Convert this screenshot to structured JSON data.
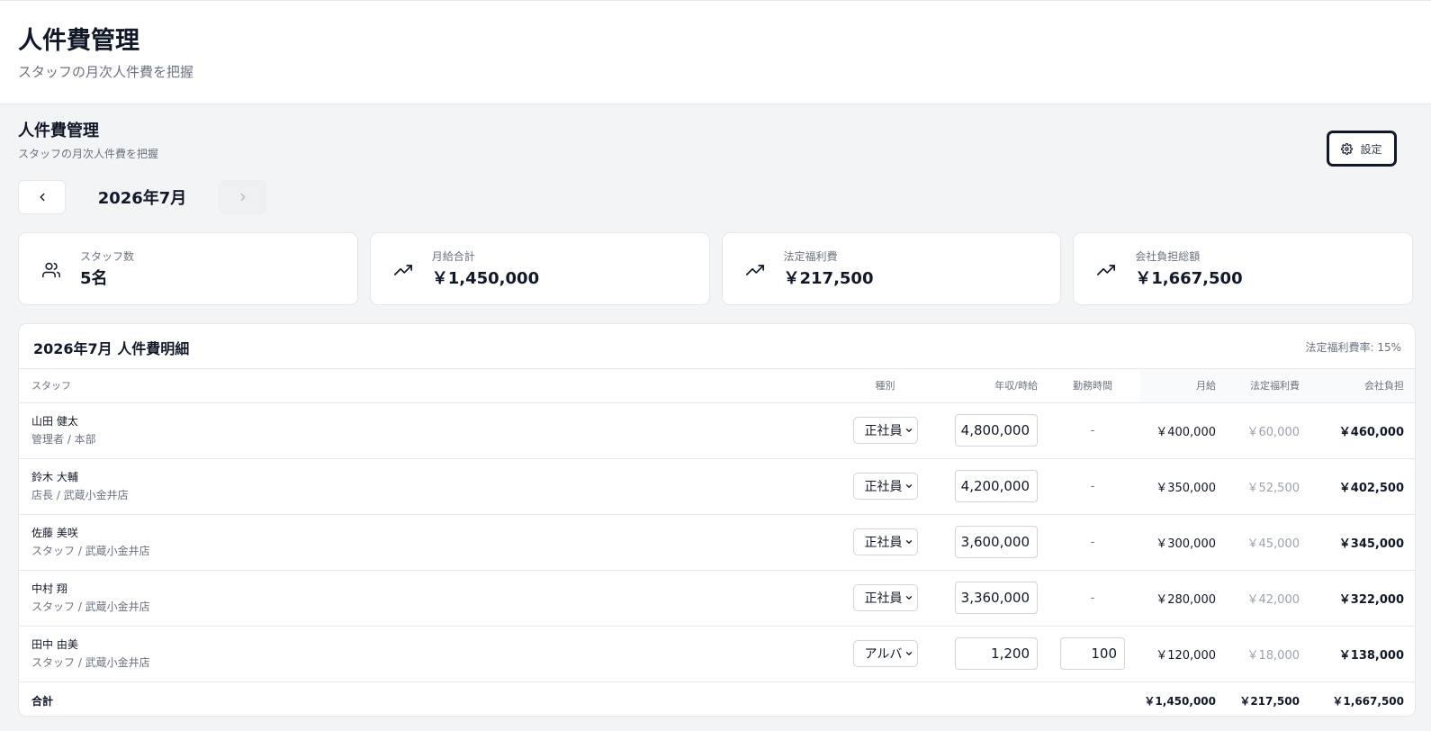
{
  "page": {
    "title": "人件費管理",
    "subtitle": "スタッフの月次人件費を把握"
  },
  "section": {
    "title": "人件費管理",
    "subtitle": "スタッフの月次人件費を把握",
    "settings_label": "設定"
  },
  "month": {
    "label": "2026年7月"
  },
  "stats": [
    {
      "label": "スタッフ数",
      "value": "5名",
      "icon": "users-icon"
    },
    {
      "label": "月給合計",
      "value": "￥1,450,000",
      "icon": "trending-up-icon"
    },
    {
      "label": "法定福利費",
      "value": "￥217,500",
      "icon": "trending-up-icon"
    },
    {
      "label": "会社負担総額",
      "value": "￥1,667,500",
      "icon": "trending-up-icon"
    }
  ],
  "table": {
    "title": "2026年7月 人件費明細",
    "rate_label": "法定福利費率: 15%",
    "headers": {
      "staff": "スタッフ",
      "type": "種別",
      "pay": "年収/時給",
      "hours": "勤務時間",
      "monthly": "月給",
      "welfare": "法定福利費",
      "burden": "会社負担"
    },
    "rows": [
      {
        "name": "山田 健太",
        "role": "管理者 / 本部",
        "type": "正社員",
        "pay": "4,800,000",
        "hours": "-",
        "monthly": "￥400,000",
        "welfare": "￥60,000",
        "burden": "￥460,000"
      },
      {
        "name": "鈴木 大輔",
        "role": "店長 / 武蔵小金井店",
        "type": "正社員",
        "pay": "4,200,000",
        "hours": "-",
        "monthly": "￥350,000",
        "welfare": "￥52,500",
        "burden": "￥402,500"
      },
      {
        "name": "佐藤 美咲",
        "role": "スタッフ / 武蔵小金井店",
        "type": "正社員",
        "pay": "3,600,000",
        "hours": "-",
        "monthly": "￥300,000",
        "welfare": "￥45,000",
        "burden": "￥345,000"
      },
      {
        "name": "中村 翔",
        "role": "スタッフ / 武蔵小金井店",
        "type": "正社員",
        "pay": "3,360,000",
        "hours": "-",
        "monthly": "￥280,000",
        "welfare": "￥42,000",
        "burden": "￥322,000"
      },
      {
        "name": "田中 由美",
        "role": "スタッフ / 武蔵小金井店",
        "type": "アルバ",
        "pay": "1,200",
        "hours": "100",
        "monthly": "￥120,000",
        "welfare": "￥18,000",
        "burden": "￥138,000"
      }
    ],
    "total": {
      "label": "合計",
      "monthly": "￥1,450,000",
      "welfare": "￥217,500",
      "burden": "￥1,667,500"
    }
  }
}
